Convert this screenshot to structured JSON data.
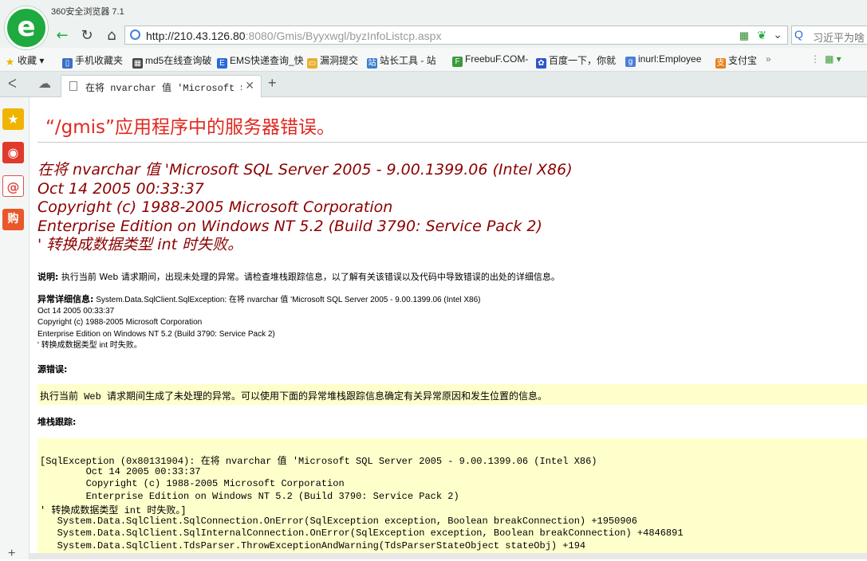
{
  "browser": {
    "logo_glyph": "e",
    "window_title": "360安全浏览器 7.1",
    "address": {
      "host": "http://210.43.126.80",
      "path": ":8080/Gmis/Byyxwgl/byzInfoListcp.aspx"
    },
    "search_text": "习近平为啥",
    "nav_glyphs": {
      "back": "←",
      "refresh": "↻",
      "home": "⌂"
    },
    "bookmarks": [
      {
        "label": "收藏",
        "icon": "star-icon",
        "color": "#f0b400"
      },
      {
        "label": "手机收藏夹",
        "icon": "phone-icon",
        "color": "#3b6fc4"
      },
      {
        "label": "md5在线查询破",
        "icon": "grid-icon",
        "color": "#444444"
      },
      {
        "label": "EMS快递查询_快",
        "icon": "ems-icon",
        "color": "#2a6ad8"
      },
      {
        "label": "漏洞提交",
        "icon": "folder-icon",
        "color": "#e8b030"
      },
      {
        "label": "站长工具 - 站",
        "icon": "site-icon",
        "color": "#3b7fd0"
      },
      {
        "label": "FreebuF.COM-",
        "icon": "freebuf-icon",
        "color": "#3b9a3b"
      },
      {
        "label": "百度一下，你就",
        "icon": "baidu-icon",
        "color": "#2d56c8"
      },
      {
        "label": "inurl:Employee",
        "icon": "google-icon",
        "color": "#4a7fd8"
      },
      {
        "label": "支付宝",
        "icon": "alipay-icon",
        "color": "#e8801a"
      }
    ],
    "tab_title": "在将 nvarchar 值 'Microsoft SQL Se"
  },
  "sidebar": [
    {
      "name": "favorites",
      "glyph": "★",
      "color": "#f0b400"
    },
    {
      "name": "weibo",
      "glyph": "◉",
      "color": "#e03a2a"
    },
    {
      "name": "mail",
      "glyph": "@",
      "color": "#e05050"
    },
    {
      "name": "shopping",
      "glyph": "购",
      "color": "#e8582a"
    }
  ],
  "page": {
    "title": "“/gmis”应用程序中的服务器错误。",
    "error_lines": [
      "在将 nvarchar 值 'Microsoft SQL Server 2005 - 9.00.1399.06 (Intel X86)",
      "Oct 14 2005 00:33:37",
      "Copyright (c) 1988-2005 Microsoft Corporation",
      "Enterprise Edition on Windows NT 5.2 (Build 3790: Service Pack 2)",
      "' 转换成数据类型 int 时失败。"
    ],
    "description_label": "说明:",
    "description_text": "执行当前 Web 请求期间，出现未处理的异常。请检查堆栈跟踪信息，以了解有关该错误以及代码中导致错误的出处的详细信息。",
    "exception_label": "异常详细信息:",
    "exception_lines": [
      "System.Data.SqlClient.SqlException: 在将 nvarchar 值 'Microsoft SQL Server 2005 - 9.00.1399.06 (Intel X86)",
      "Oct 14 2005 00:33:37",
      "Copyright (c) 1988-2005 Microsoft Corporation",
      "Enterprise Edition on Windows NT 5.2 (Build 3790: Service Pack 2)",
      "' 转换成数据类型 int 时失败。"
    ],
    "source_error_label": "源错误:",
    "source_error_text": "执行当前 Web 请求期间生成了未处理的异常。可以使用下面的异常堆栈跟踪信息确定有关异常原因和发生位置的信息。",
    "stack_label": "堆栈跟踪:",
    "stack_lines": [
      "[SqlException (0x80131904): 在将 nvarchar 值 'Microsoft SQL Server 2005 - 9.00.1399.06 (Intel X86)",
      "\tOct 14 2005 00:33:37",
      "\tCopyright (c) 1988-2005 Microsoft Corporation",
      "\tEnterprise Edition on Windows NT 5.2 (Build 3790: Service Pack 2)",
      "' 转换成数据类型 int 时失败。]",
      "   System.Data.SqlClient.SqlConnection.OnError(SqlException exception, Boolean breakConnection) +1950906",
      "   System.Data.SqlClient.SqlInternalConnection.OnError(SqlException exception, Boolean breakConnection) +4846891",
      "   System.Data.SqlClient.TdsParser.ThrowExceptionAndWarning(TdsParserStateObject stateObj) +194"
    ]
  }
}
